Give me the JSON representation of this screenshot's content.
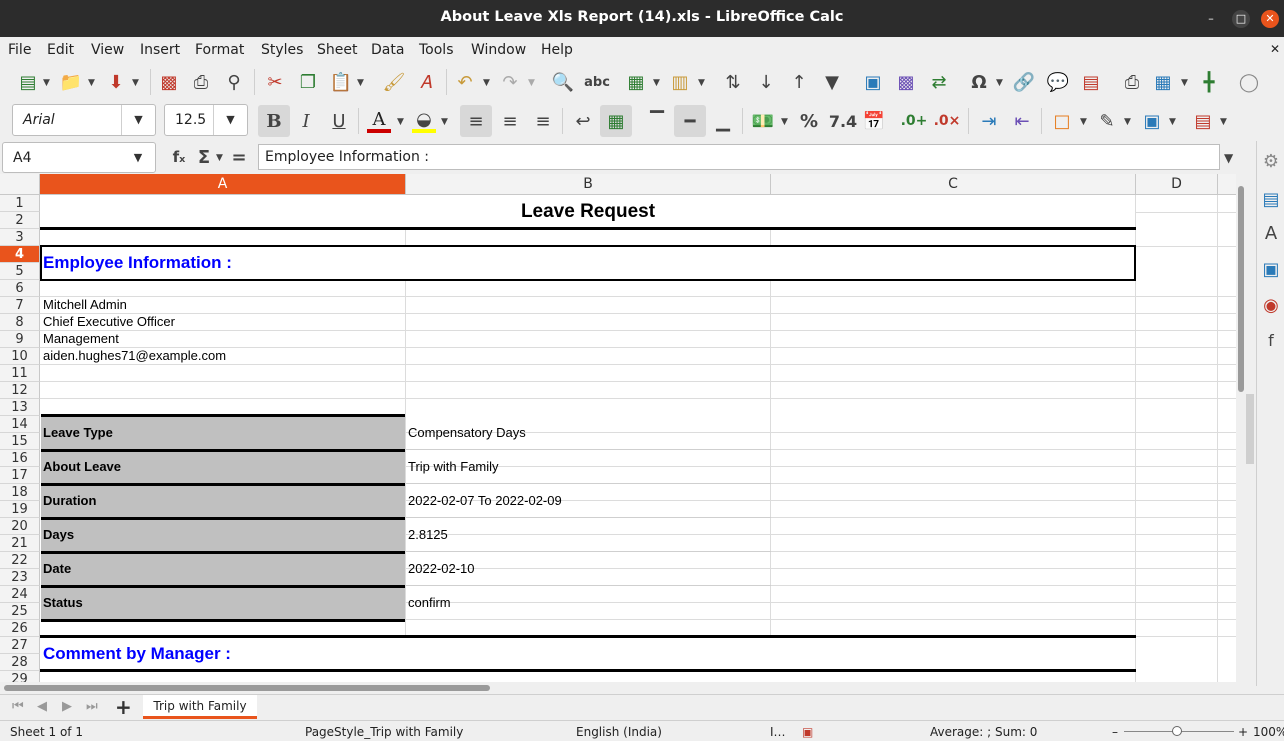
{
  "window": {
    "title": "About Leave Xls Report (14).xls - LibreOffice Calc"
  },
  "menu": [
    "File",
    "Edit",
    "View",
    "Insert",
    "Format",
    "Styles",
    "Sheet",
    "Data",
    "Tools",
    "Window",
    "Help"
  ],
  "format_toolbar": {
    "font_name": "Arial",
    "font_size": "12.5",
    "number_format_decimal": "7.4",
    "percent": "%"
  },
  "formula_bar": {
    "name_box": "A4",
    "content": "Employee Information :"
  },
  "columns": [
    "A",
    "B",
    "C",
    "D"
  ],
  "rows": [
    "1",
    "2",
    "3",
    "4",
    "5",
    "6",
    "7",
    "8",
    "9",
    "10",
    "11",
    "12",
    "13",
    "14",
    "15",
    "16",
    "17",
    "18",
    "19",
    "20",
    "21",
    "22",
    "23",
    "24",
    "25",
    "26",
    "27",
    "28",
    "29"
  ],
  "sheet": {
    "title": "Leave Request",
    "employee_header": "Employee Information :",
    "employee": [
      "Mitchell Admin",
      "Chief Executive Officer",
      "Management",
      "aiden.hughes71@example.com"
    ],
    "details": [
      {
        "label": "Leave Type",
        "value": "Compensatory Days"
      },
      {
        "label": "About Leave",
        "value": "Trip with Family"
      },
      {
        "label": "Duration",
        "value": "2022-02-07 To 2022-02-09"
      },
      {
        "label": "Days",
        "value": "2.8125"
      },
      {
        "label": "Date",
        "value": "2022-02-10"
      },
      {
        "label": "Status",
        "value": "confirm"
      }
    ],
    "comment_header": "Comment by Manager :"
  },
  "tabs": {
    "active": "Trip with Family"
  },
  "status": {
    "sheet": "Sheet 1 of 1",
    "page_style": "PageStyle_Trip with Family",
    "language": "English (India)",
    "summary": "Average: ; Sum: 0",
    "zoom": "100%"
  },
  "colors": {
    "accent": "#e9541c",
    "header_blue": "#0000ff",
    "label_grey": "#c0c0c0"
  }
}
